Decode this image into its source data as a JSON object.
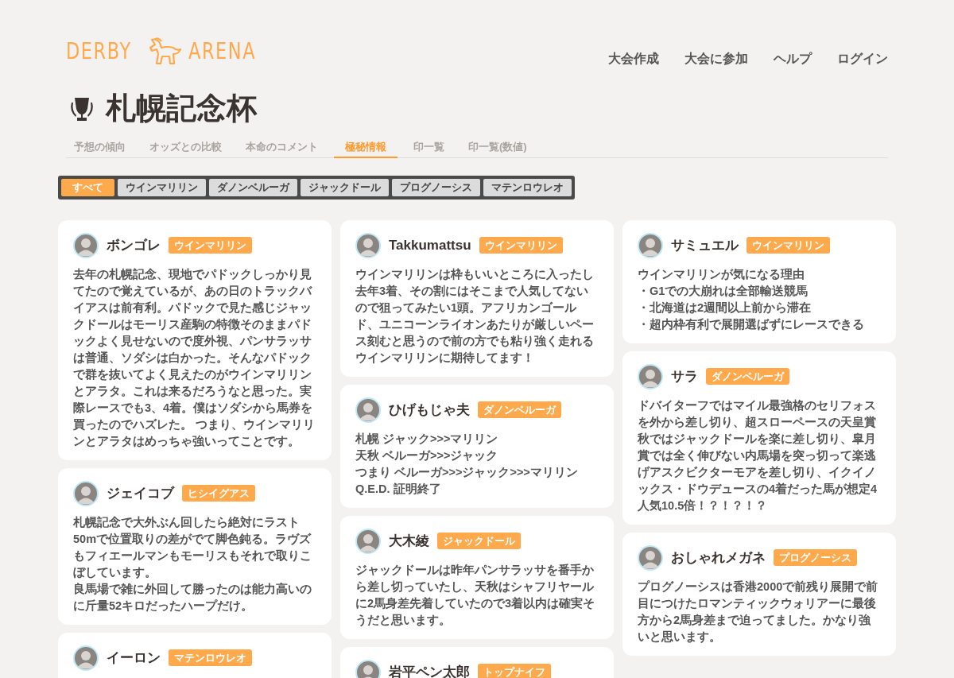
{
  "logo": {
    "left": "DERBY",
    "right": "ARENA"
  },
  "nav": [
    "大会作成",
    "大会に参加",
    "ヘルプ",
    "ログイン"
  ],
  "title": "札幌記念杯",
  "tabs": [
    {
      "label": "予想の傾向",
      "selected": false
    },
    {
      "label": "オッズとの比較",
      "selected": false
    },
    {
      "label": "本命のコメント",
      "selected": false
    },
    {
      "label": "極秘情報",
      "selected": true
    },
    {
      "label": "印一覧",
      "selected": false
    },
    {
      "label": "印一覧(数値)",
      "selected": false
    }
  ],
  "filters": [
    {
      "label": "すべて",
      "selected": true
    },
    {
      "label": "ウインマリリン",
      "selected": false
    },
    {
      "label": "ダノンベルーガ",
      "selected": false
    },
    {
      "label": "ジャックドール",
      "selected": false
    },
    {
      "label": "プログノーシス",
      "selected": false
    },
    {
      "label": "マテンロウレオ",
      "selected": false
    }
  ],
  "comment_columns": [
    {
      "cards": [
        {
          "user": "ボンゴレ",
          "horse": "ウインマリリン",
          "lines": [
            "去年の札幌記念、現地でパドックしっかり見てたので覚えているが、あの日のトラックバイアスは前有利。パドックで見た感じジャックドールはモーリス産駒の特徴そのままパドックよく見せないので度外視、パンサラッサは普通、ソダシは白かった。そんなパドックで群を抜いてよく見えたのがウインマリリンとアラタ。これは来るだろうなと思った。実際レースでも3、4着。僕はソダシから馬券を買ったのでハズレた。 つまり、ウインマリリンとアラタはめっちゃ強いってことです。"
          ]
        },
        {
          "user": "ジェイコブ",
          "horse": "ヒシイグアス",
          "lines": [
            "札幌記念で大外ぶん回したら絶対にラスト50mで位置取りの差がでて脚色鈍る。ラヴズもフィエールマンもモーリスもそれで取りこぼしています。",
            "良馬場で雑に外回して勝ったのは能力高いのに斤量52キロだったハープだけ。"
          ]
        },
        {
          "user": "イーロン",
          "horse": "マテンロウレオ"
        }
      ]
    },
    {
      "cards": [
        {
          "user": "Takkumattsu",
          "horse": "ウインマリリン",
          "lines": [
            "ウインマリリンは枠もいいところに入ったし去年3着、その割にはそこまで人気してないので狙ってみたい1頭。アフリカンゴールド、ユニコーンライオンあたりが厳しいペース刻むと思うので前の方でも粘り強く走れるウインマリリンに期待してます！"
          ]
        },
        {
          "user": "ひげもじゃ夫",
          "horse": "ダノンベルーガ",
          "lines": [
            "札幌 ジャック>>>マリリン",
            "天秋 ベルーガ>>>ジャック",
            "つまり ベルーガ>>>ジャック>>>マリリン",
            "Q.E.D. 証明終了"
          ]
        },
        {
          "user": "大木綾",
          "horse": "ジャックドール",
          "lines": [
            "ジャックドールは昨年パンサラッサを番手から差し切っていたし、天秋はシャフリヤールに2馬身差先着していたので3着以内は確実そうだと思います。"
          ]
        },
        {
          "user": "岩平ペン太郎",
          "horse": "トップナイフ"
        }
      ]
    },
    {
      "cards": [
        {
          "user": "サミュエル",
          "horse": "ウインマリリン",
          "lines": [
            "ウインマリリンが気になる理由",
            "・G1での大崩れは全部輸送競馬",
            "・北海道は2週間以上前から滞在",
            "・超内枠有利で展開選ばずにレースできる"
          ]
        },
        {
          "user": "サラ",
          "horse": "ダノンベルーガ",
          "lines": [
            "ドバイターフではマイル最強格のセリフォスを外から差し切り、超スローペースの天皇賞秋ではジャックドールを楽に差し切り、皐月賞では全く伸びない内馬場を突っ切って楽逃げアスクビクターモアを差し切り、イクイノックス・ドウデュースの4着だった馬が想定4人気10.5倍！？！？！？"
          ]
        },
        {
          "user": "おしゃれメガネ",
          "horse": "プログノーシス",
          "lines": [
            "プログノーシスは香港2000で前残り展開で前目につけたロマンティックウォリアーに最後方から2馬身差まで迫ってました。かなり強いと思います。"
          ]
        }
      ]
    }
  ]
}
